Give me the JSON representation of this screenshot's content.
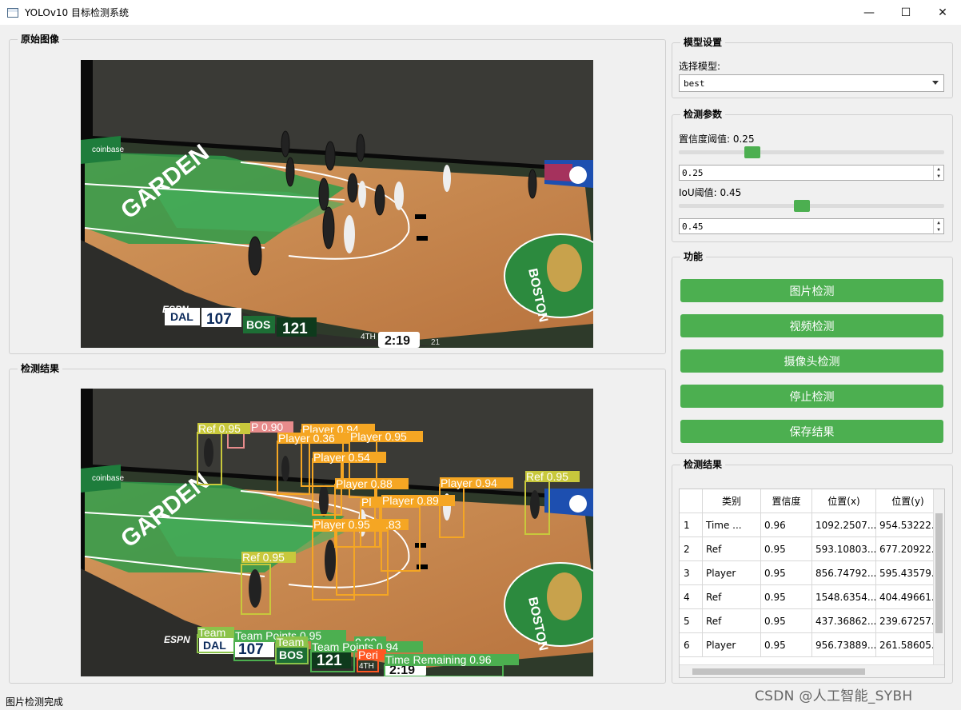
{
  "window": {
    "title": "YOLOv10 目标检测系统",
    "minimize_glyph": "—",
    "maximize_glyph": "☐",
    "close_glyph": "✕"
  },
  "panels": {
    "original_title": "原始图像",
    "result_title": "检测结果"
  },
  "model": {
    "group_title": "模型设置",
    "label": "选择模型:",
    "value": "best"
  },
  "params": {
    "group_title": "检测参数",
    "conf_label": "置信度阈值: 0.25",
    "conf_value": "0.25",
    "conf_fraction": 0.25,
    "iou_label": "IoU阈值: 0.45",
    "iou_value": "0.45",
    "iou_fraction": 0.45
  },
  "functions": {
    "group_title": "功能",
    "buttons": [
      "图片检测",
      "视频检测",
      "摄像头检测",
      "停止检测",
      "保存结果"
    ],
    "color": "#4caf50"
  },
  "results": {
    "group_title": "检测结果",
    "columns": [
      "类别",
      "置信度",
      "位置(x)",
      "位置(y)"
    ],
    "rows": [
      {
        "n": "1",
        "cls": "Time ...",
        "conf": "0.96",
        "x": "1092.2507...",
        "y": "954.53222..."
      },
      {
        "n": "2",
        "cls": "Ref",
        "conf": "0.95",
        "x": "593.10803...",
        "y": "677.20922..."
      },
      {
        "n": "3",
        "cls": "Player",
        "conf": "0.95",
        "x": "856.74792...",
        "y": "595.43579..."
      },
      {
        "n": "4",
        "cls": "Ref",
        "conf": "0.95",
        "x": "1548.6354...",
        "y": "404.49661..."
      },
      {
        "n": "5",
        "cls": "Ref",
        "conf": "0.95",
        "x": "437.36862...",
        "y": "239.67257..."
      },
      {
        "n": "6",
        "cls": "Player",
        "conf": "0.95",
        "x": "956.73889...",
        "y": "261.58605..."
      }
    ]
  },
  "scene": {
    "wall_text": "GARDEN",
    "sponsor": "coinbase",
    "network": "ESPN",
    "logo_text": "BOSTON",
    "team1": "DAL",
    "score1": "107",
    "team2": "BOS",
    "score2": "121",
    "period": "4TH",
    "clock": "2:19",
    "shot_clock": "21"
  },
  "detections": [
    {
      "label": "Ref 0.95",
      "color": "#c8c83c"
    },
    {
      "label": "P 0.90",
      "color": "#e88c8c"
    },
    {
      "label": "Player 0.94",
      "color": "#f5a623"
    },
    {
      "label": "Player 0.36",
      "color": "#f5a623"
    },
    {
      "label": "Player 0.95",
      "color": "#f5a623"
    },
    {
      "label": "Player 0.54",
      "color": "#f5a623"
    },
    {
      "label": "Player 0.88",
      "color": "#f5a623"
    },
    {
      "label": "Player 0.94",
      "color": "#f5a623"
    },
    {
      "label": "Ref 0.95",
      "color": "#c8c83c"
    },
    {
      "label": "Pl",
      "color": "#f5a623"
    },
    {
      "label": "Player 0.89",
      "color": "#f5a623"
    },
    {
      "label": "Player 0.95",
      "color": "#f5a623"
    },
    {
      "label": ".83",
      "color": "#f5a623"
    },
    {
      "label": "Ref 0.95",
      "color": "#c8c83c"
    },
    {
      "label": "Team",
      "color": "#8bc34a"
    },
    {
      "label": "Team Points 0.95",
      "color": "#4caf50"
    },
    {
      "label": "Team",
      "color": "#8bc34a"
    },
    {
      "label": "0.90",
      "color": "#4caf50"
    },
    {
      "label": "Team Points 0.94",
      "color": "#4caf50"
    },
    {
      "label": "Peri",
      "color": "#ff5722"
    },
    {
      "label": "Time Remaining 0.96",
      "color": "#4caf50"
    }
  ],
  "status": "图片检测完成",
  "watermark": "CSDN @人工智能_SYBH"
}
